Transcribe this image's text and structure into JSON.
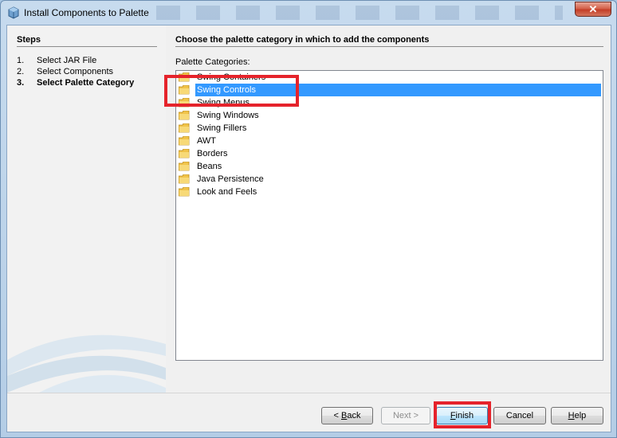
{
  "window": {
    "title": "Install Components to Palette",
    "close_glyph": "✕"
  },
  "steps": {
    "title": "Steps",
    "items": [
      {
        "num": "1.",
        "label": "Select JAR File"
      },
      {
        "num": "2.",
        "label": "Select Components"
      },
      {
        "num": "3.",
        "label": "Select Palette Category"
      }
    ],
    "current_index": 2
  },
  "content": {
    "title": "Choose the palette category in which to add the components",
    "list_label": "Palette Categories:",
    "categories": [
      "Swing Containers",
      "Swing Controls",
      "Swing Menus",
      "Swing Windows",
      "Swing Fillers",
      "AWT",
      "Borders",
      "Beans",
      "Java Persistence",
      "Look and Feels"
    ],
    "selected_index": 1,
    "icon": "folder-icon"
  },
  "buttons": {
    "back": {
      "pre": "< ",
      "mnemonic": "B",
      "post": "ack"
    },
    "next": {
      "label": "Next >"
    },
    "finish": {
      "mnemonic": "F",
      "post": "inish"
    },
    "cancel": {
      "label": "Cancel"
    },
    "help": {
      "mnemonic": "H",
      "post": "elp"
    }
  },
  "colors": {
    "selection": "#3399ff",
    "annotation": "#e5232b"
  }
}
